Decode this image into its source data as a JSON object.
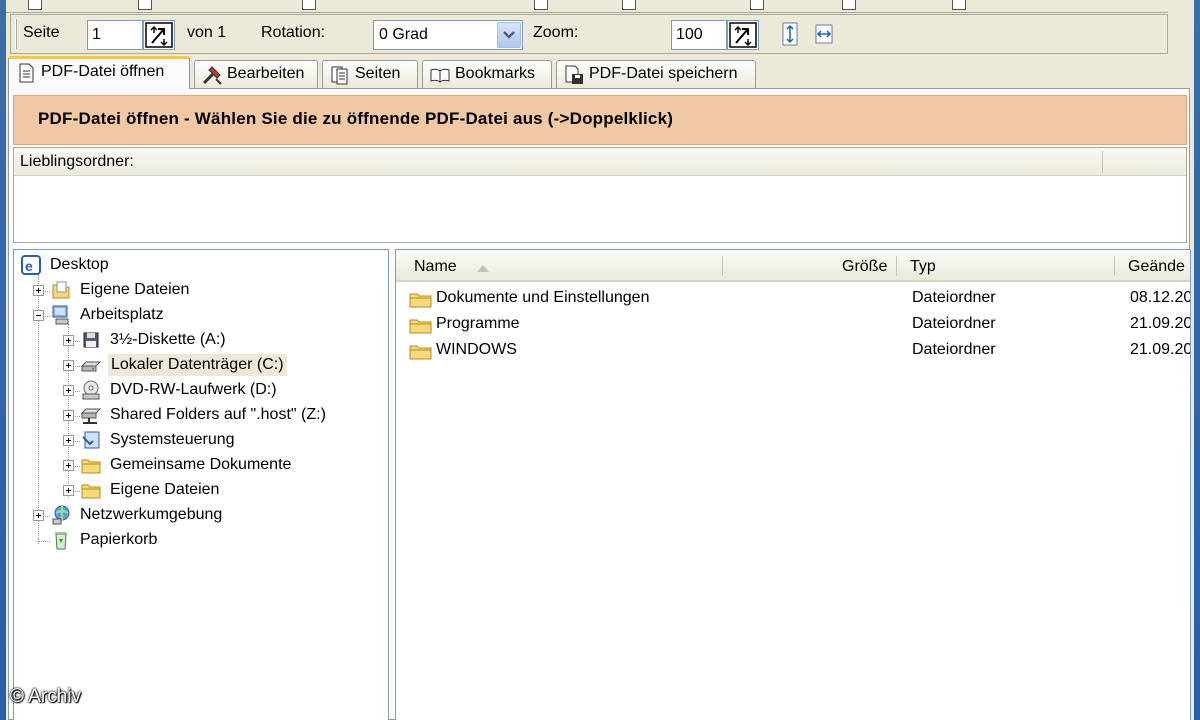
{
  "toolbar2": {
    "page_label": "Seite",
    "page_value": "1",
    "page_of": "von 1",
    "rotation_label": "Rotation:",
    "rotation_value": "0 Grad",
    "zoom_label": "Zoom:",
    "zoom_value": "100"
  },
  "tabs": [
    {
      "label": "PDF-Datei öffnen",
      "icon": "document-icon",
      "active": true
    },
    {
      "label": "Bearbeiten",
      "icon": "tools-icon",
      "active": false
    },
    {
      "label": "Seiten",
      "icon": "pages-icon",
      "active": false
    },
    {
      "label": "Bookmarks",
      "icon": "book-icon",
      "active": false
    },
    {
      "label": "PDF-Datei speichern",
      "icon": "save-icon",
      "active": false
    }
  ],
  "banner": "PDF-Datei öffnen - Wählen Sie die zu öffnende PDF-Datei aus (->Doppelklick)",
  "favorites": {
    "header": "Lieblingsordner:"
  },
  "tree": [
    {
      "label": "Desktop",
      "icon": "desktop-icon",
      "level": 0
    },
    {
      "label": "Eigene Dateien",
      "icon": "my-documents-icon",
      "level": 1,
      "expander": "plus"
    },
    {
      "label": "Arbeitsplatz",
      "icon": "my-computer-icon",
      "level": 1,
      "expander": "minus"
    },
    {
      "label": "3½-Diskette (A:)",
      "icon": "floppy-icon",
      "level": 2,
      "expander": "plus"
    },
    {
      "label": "Lokaler Datenträger (C:)",
      "icon": "harddisk-icon",
      "level": 2,
      "expander": "plus",
      "selected": true
    },
    {
      "label": "DVD-RW-Laufwerk (D:)",
      "icon": "dvd-drive-icon",
      "level": 2,
      "expander": "plus"
    },
    {
      "label": "Shared Folders auf \".host\" (Z:)",
      "icon": "network-drive-icon",
      "level": 2,
      "expander": "plus"
    },
    {
      "label": "Systemsteuerung",
      "icon": "control-panel-icon",
      "level": 2,
      "expander": "plus"
    },
    {
      "label": "Gemeinsame Dokumente",
      "icon": "folder-icon",
      "level": 2,
      "expander": "plus"
    },
    {
      "label": "Eigene Dateien",
      "icon": "folder-icon",
      "level": 2,
      "expander": "plus"
    },
    {
      "label": "Netzwerkumgebung",
      "icon": "network-icon",
      "level": 1,
      "expander": "plus"
    },
    {
      "label": "Papierkorb",
      "icon": "recycle-bin-icon",
      "level": 1
    }
  ],
  "files": {
    "columns": [
      "Name",
      "Größe",
      "Typ",
      "Geände"
    ],
    "rows": [
      {
        "name": "Dokumente und Einstellungen",
        "type": "Dateiordner",
        "date": "08.12.20"
      },
      {
        "name": "Programme",
        "type": "Dateiordner",
        "date": "21.09.20"
      },
      {
        "name": "WINDOWS",
        "type": "Dateiordner",
        "date": "21.09.20"
      }
    ]
  },
  "watermark": "© Archiv",
  "colors": {
    "banner_bg": "#f1c8a5",
    "window_bg": "#ece9d8",
    "active_tab_accent": "#ffc83c"
  }
}
